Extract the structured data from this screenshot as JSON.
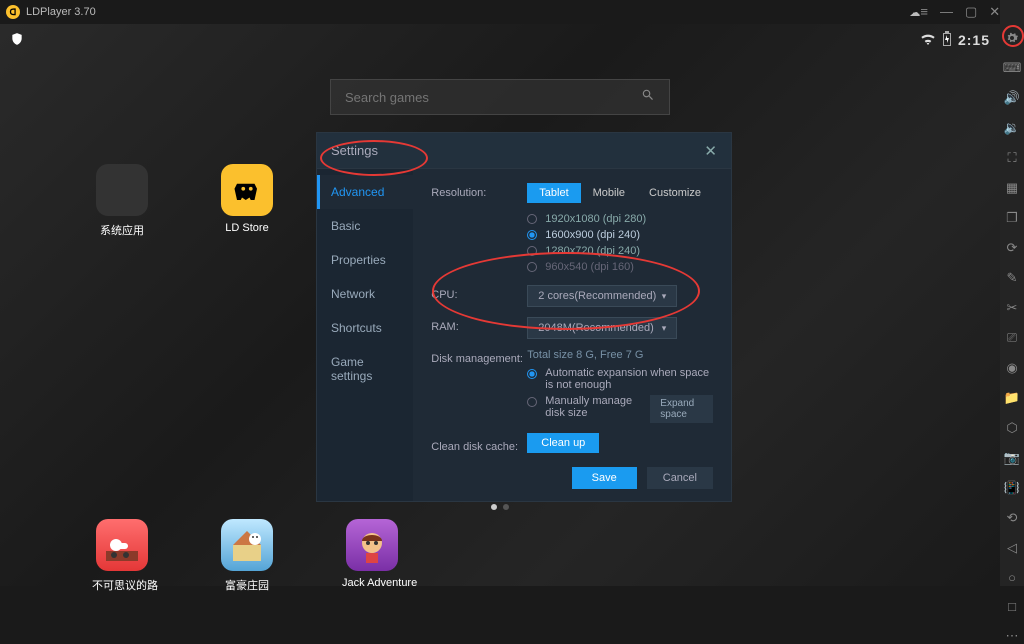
{
  "titlebar": {
    "title": "LDPlayer 3.70"
  },
  "status": {
    "time": "2:15"
  },
  "search": {
    "placeholder": "Search games"
  },
  "apps": {
    "sysapps": {
      "label": "系统应用"
    },
    "ldstore": {
      "label": "LD Store"
    },
    "road": {
      "label": "不可思议的路"
    },
    "manor": {
      "label": "富豪庄园"
    },
    "jack": {
      "label": "Jack Adventure"
    }
  },
  "modal": {
    "title": "Settings",
    "nav": {
      "advanced": "Advanced",
      "basic": "Basic",
      "properties": "Properties",
      "network": "Network",
      "shortcuts": "Shortcuts",
      "game_settings": "Game settings"
    },
    "resolution": {
      "label": "Resolution:",
      "tabs": {
        "tablet": "Tablet",
        "mobile": "Mobile",
        "customize": "Customize"
      },
      "options": {
        "r1": "1920x1080  (dpi 280)",
        "r2": "1600x900  (dpi 240)",
        "r3": "1280x720  (dpi 240)",
        "r4": "960x540  (dpi 160)"
      }
    },
    "cpu": {
      "label": "CPU:",
      "value": "2 cores(Recommended)"
    },
    "ram": {
      "label": "RAM:",
      "value": "2048M(Recommended)"
    },
    "disk": {
      "label": "Disk management:",
      "total": "Total size 8 G,  Free 7 G",
      "opt1": "Automatic expansion when space is not enough",
      "opt2": "Manually manage disk size",
      "expand": "Expand space"
    },
    "clean": {
      "label": "Clean disk cache:",
      "btn": "Clean up"
    },
    "save": "Save",
    "cancel": "Cancel"
  }
}
